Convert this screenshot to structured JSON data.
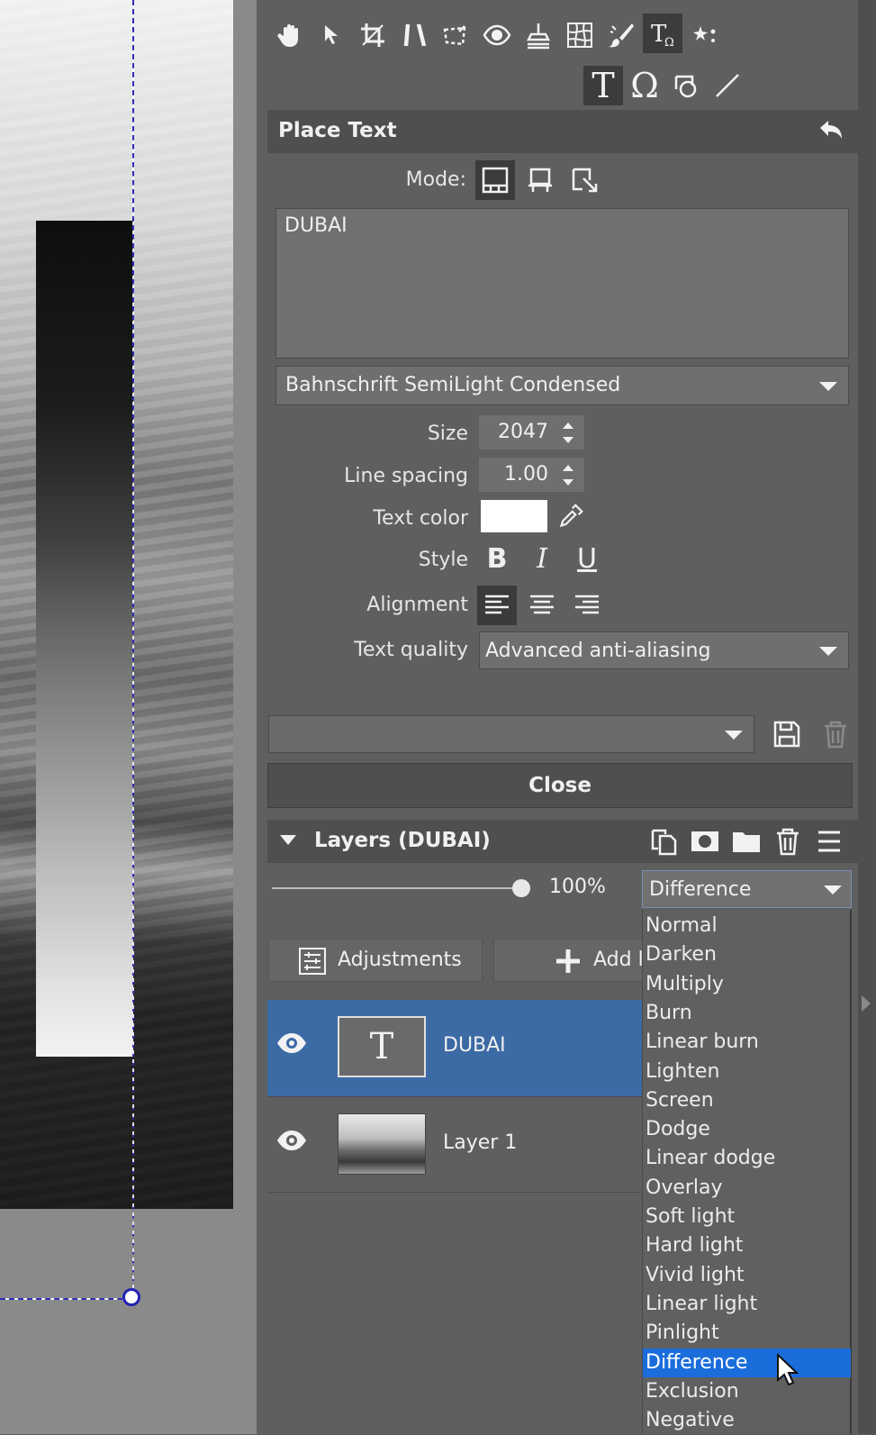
{
  "toolbar": {
    "row1": [
      "hand-icon",
      "pointer-icon",
      "crop-icon",
      "straighten-icon",
      "transform-icon",
      "red-eye-icon",
      "clone-stamp-icon",
      "mesh-icon",
      "brush-icon",
      "text-tool-icon",
      "effects-icon"
    ],
    "row2": [
      "text-icon",
      "symbol-icon",
      "shape-icon",
      "line-icon"
    ],
    "text_tool_glyph": "T",
    "symbol_glyph": "Ω"
  },
  "place_text": {
    "title": "Place Text",
    "mode_label": "Mode:",
    "text_value": "DUBAI",
    "font": "Bahnschrift SemiLight Condensed",
    "size_label": "Size",
    "size_value": "2047",
    "line_spacing_label": "Line spacing",
    "line_spacing_value": "1.00",
    "text_color_label": "Text color",
    "text_color": "#ffffff",
    "style_label": "Style",
    "bold": "B",
    "italic": "I",
    "underline": "U",
    "alignment_label": "Alignment",
    "quality_label": "Text quality",
    "quality_value": "Advanced anti-aliasing",
    "preset_value": "",
    "close_label": "Close"
  },
  "layers": {
    "title": "Layers (DUBAI)",
    "opacity": "100%",
    "opacity_fraction": 1.0,
    "blend_mode": "Difference",
    "adjustments_label": "Adjustments",
    "add_label": "Add l",
    "items": [
      {
        "name": "DUBAI",
        "thumb_glyph": "T",
        "selected": true
      },
      {
        "name": "Layer 1",
        "selected": false
      }
    ]
  },
  "blend_options": [
    "Normal",
    "Darken",
    "Multiply",
    "Burn",
    "Linear burn",
    "Lighten",
    "Screen",
    "Dodge",
    "Linear dodge",
    "Overlay",
    "Soft light",
    "Hard light",
    "Vivid light",
    "Linear light",
    "Pinlight",
    "Difference",
    "Exclusion",
    "Negative"
  ],
  "selected_blend_index": 15,
  "colors": {
    "panel": "#5f5f5f",
    "header": "#4f4f4f",
    "selected_layer": "#3c6aa5",
    "selected_option": "#1a6ddb",
    "guide": "#2e2eb8"
  }
}
